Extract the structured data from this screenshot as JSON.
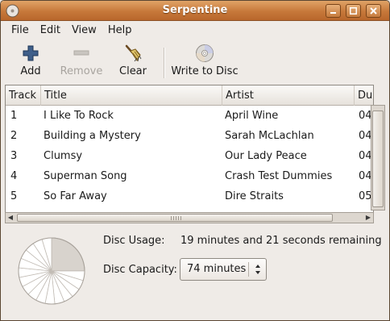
{
  "window": {
    "title": "Serpentine"
  },
  "menu": {
    "items": [
      "File",
      "Edit",
      "View",
      "Help"
    ]
  },
  "toolbar": {
    "add_label": "Add",
    "remove_label": "Remove",
    "clear_label": "Clear",
    "write_label": "Write to Disc"
  },
  "tracks": {
    "columns": [
      "Track",
      "Title",
      "Artist",
      "Du"
    ],
    "rows": [
      {
        "track": "1",
        "title": "I Like To Rock",
        "artist": "April Wine",
        "duration": "04"
      },
      {
        "track": "2",
        "title": "Building a Mystery",
        "artist": "Sarah McLachlan",
        "duration": "04"
      },
      {
        "track": "3",
        "title": "Clumsy",
        "artist": "Our Lady Peace",
        "duration": "04"
      },
      {
        "track": "4",
        "title": "Superman Song",
        "artist": "Crash Test Dummies",
        "duration": "04"
      },
      {
        "track": "5",
        "title": "So Far Away",
        "artist": "Dire Straits",
        "duration": "05"
      }
    ]
  },
  "disc": {
    "usage_label": "Disc Usage:",
    "usage_value": "19 minutes and 21 seconds remaining",
    "capacity_label": "Disc Capacity:",
    "capacity_value": "74 minutes",
    "used_fraction": 0.25
  },
  "colors": {
    "titlebar": "#c7783a",
    "usage_used": "#d8d3cd",
    "usage_free": "#ffffff"
  }
}
